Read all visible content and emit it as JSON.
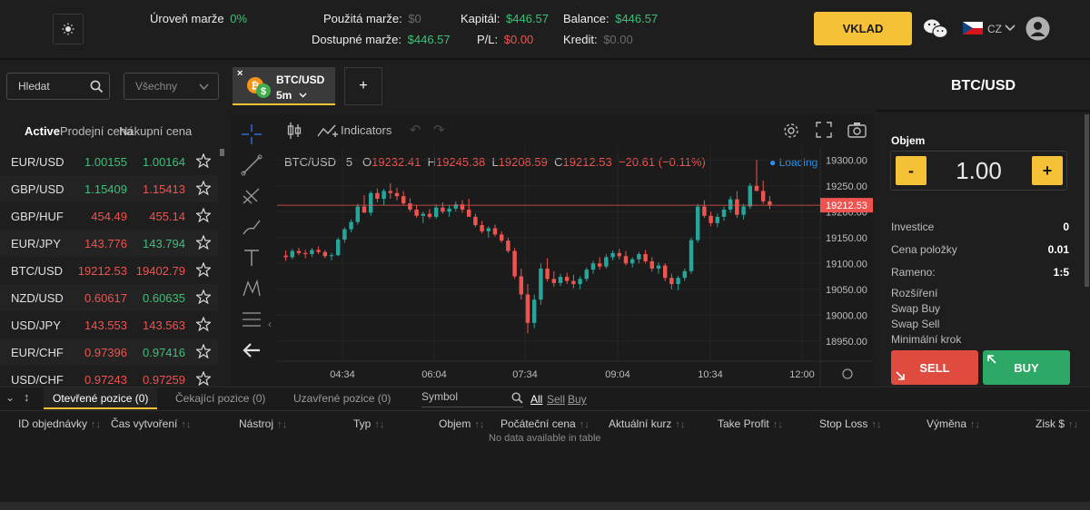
{
  "topbar": {
    "margin_level_label": "Úroveň marže",
    "margin_level_value": "0%",
    "used_margin_label": "Použitá marže:",
    "used_margin_value": "$0",
    "free_margin_label": "Dostupné marže:",
    "free_margin_value": "$446.57",
    "equity_label": "Kapitál:",
    "equity_value": "$446.57",
    "pl_label": "P/L:",
    "pl_value": "$0.00",
    "balance_label": "Balance:",
    "balance_value": "$446.57",
    "credit_label": "Kredit:",
    "credit_value": "$0.00",
    "deposit_label": "VKLAD",
    "language": "CZ",
    "icons": [
      "sun-icon",
      "wechat-icon",
      "czech-flag-icon",
      "chevron-down-icon",
      "user-avatar-icon"
    ]
  },
  "watchlist": {
    "search_placeholder": "Hledat",
    "filter_value": "Všechny",
    "col_active": "Active",
    "col_bid": "Prodejní cena",
    "col_ask": "Nákupní cena",
    "rows": [
      {
        "symbol": "EUR/USD",
        "bid": "1.00155",
        "ask": "1.00164",
        "bid_color": "#3fbf78",
        "ask_color": "#3fbf78"
      },
      {
        "symbol": "GBP/USD",
        "bid": "1.15409",
        "ask": "1.15413",
        "bid_color": "#3fbf78",
        "ask_color": "#ef5350"
      },
      {
        "symbol": "GBP/HUF",
        "bid": "454.49",
        "ask": "455.14",
        "bid_color": "#ef5350",
        "ask_color": "#ef5350"
      },
      {
        "symbol": "EUR/JPY",
        "bid": "143.776",
        "ask": "143.794",
        "bid_color": "#ef5350",
        "ask_color": "#3fbf78"
      },
      {
        "symbol": "BTC/USD",
        "bid": "19212.53",
        "ask": "19402.79",
        "bid_color": "#ef5350",
        "ask_color": "#ef5350"
      },
      {
        "symbol": "NZD/USD",
        "bid": "0.60617",
        "ask": "0.60635",
        "bid_color": "#ef5350",
        "ask_color": "#3fbf78"
      },
      {
        "symbol": "USD/JPY",
        "bid": "143.553",
        "ask": "143.563",
        "bid_color": "#ef5350",
        "ask_color": "#ef5350"
      },
      {
        "symbol": "EUR/CHF",
        "bid": "0.97396",
        "ask": "0.97416",
        "bid_color": "#ef5350",
        "ask_color": "#3fbf78"
      },
      {
        "symbol": "USD/CHF",
        "bid": "0.97243",
        "ask": "0.97259",
        "bid_color": "#ef5350",
        "ask_color": "#ef5350"
      }
    ]
  },
  "chart_tab": {
    "symbol": "BTC/USD",
    "timeframe": "5m",
    "add_label": "+"
  },
  "chart_toolbar": {
    "indicators_label": "Indicators"
  },
  "chart_legend": {
    "symbol": "BTC/USD",
    "interval": "5",
    "o_label": "O",
    "o": "19232.41",
    "h_label": "H",
    "h": "19245.38",
    "l_label": "L",
    "l": "19208.59",
    "c_label": "C",
    "c": "19212.53",
    "change": "−20.61 (−0.11%)",
    "loading": "Loading"
  },
  "chart_data": {
    "type": "candlestick",
    "title": "",
    "y_ticks": [
      "19300.00",
      "19250.00",
      "19200.00",
      "19150.00",
      "19100.00",
      "19050.00",
      "19000.00",
      "18950.00"
    ],
    "x_ticks": [
      "04:34",
      "06:04",
      "07:34",
      "09:04",
      "10:34",
      "12:00"
    ],
    "ylim": [
      18925,
      19325
    ],
    "last_price": "19212.53",
    "up_color": "#26a69a",
    "down_color": "#ef5350",
    "candles": [
      [
        19115,
        19125,
        19105,
        19112
      ],
      [
        19112,
        19128,
        19108,
        19124
      ],
      [
        19124,
        19130,
        19116,
        19120
      ],
      [
        19120,
        19126,
        19110,
        19118
      ],
      [
        19118,
        19130,
        19112,
        19126
      ],
      [
        19126,
        19133,
        19118,
        19122
      ],
      [
        19122,
        19126,
        19110,
        19114
      ],
      [
        19114,
        19120,
        19106,
        19116
      ],
      [
        19116,
        19150,
        19114,
        19146
      ],
      [
        19146,
        19170,
        19140,
        19166
      ],
      [
        19166,
        19185,
        19160,
        19180
      ],
      [
        19180,
        19215,
        19175,
        19210
      ],
      [
        19210,
        19232,
        19200,
        19198
      ],
      [
        19198,
        19240,
        19192,
        19236
      ],
      [
        19236,
        19245,
        19218,
        19225
      ],
      [
        19225,
        19244,
        19212,
        19240
      ],
      [
        19240,
        19255,
        19225,
        19236
      ],
      [
        19236,
        19246,
        19222,
        19230
      ],
      [
        19230,
        19240,
        19212,
        19216
      ],
      [
        19216,
        19226,
        19200,
        19204
      ],
      [
        19204,
        19212,
        19188,
        19192
      ],
      [
        19192,
        19200,
        19178,
        19196
      ],
      [
        19196,
        19205,
        19186,
        19190
      ],
      [
        19190,
        19214,
        19186,
        19208
      ],
      [
        19208,
        19218,
        19196,
        19200
      ],
      [
        19200,
        19212,
        19190,
        19206
      ],
      [
        19206,
        19220,
        19200,
        19214
      ],
      [
        19214,
        19222,
        19198,
        19204
      ],
      [
        19204,
        19225,
        19196,
        19190
      ],
      [
        19190,
        19196,
        19170,
        19174
      ],
      [
        19174,
        19182,
        19158,
        19162
      ],
      [
        19162,
        19172,
        19150,
        19168
      ],
      [
        19168,
        19175,
        19152,
        19156
      ],
      [
        19156,
        19162,
        19140,
        19144
      ],
      [
        19144,
        19150,
        19120,
        19124
      ],
      [
        19124,
        19130,
        19070,
        19075
      ],
      [
        19075,
        19090,
        19030,
        19040
      ],
      [
        19040,
        19060,
        18965,
        18985
      ],
      [
        18985,
        19040,
        18975,
        19030
      ],
      [
        19030,
        19100,
        19020,
        19090
      ],
      [
        19090,
        19110,
        19065,
        19070
      ],
      [
        19070,
        19085,
        19055,
        19062
      ],
      [
        19062,
        19080,
        19056,
        19074
      ],
      [
        19074,
        19082,
        19060,
        19066
      ],
      [
        19066,
        19078,
        19052,
        19060
      ],
      [
        19060,
        19075,
        19050,
        19070
      ],
      [
        19070,
        19092,
        19065,
        19088
      ],
      [
        19088,
        19105,
        19080,
        19100
      ],
      [
        19100,
        19112,
        19088,
        19094
      ],
      [
        19094,
        19118,
        19090,
        19112
      ],
      [
        19112,
        19125,
        19106,
        19120
      ],
      [
        19120,
        19128,
        19108,
        19114
      ],
      [
        19114,
        19124,
        19096,
        19100
      ],
      [
        19100,
        19112,
        19092,
        19108
      ],
      [
        19108,
        19122,
        19100,
        19118
      ],
      [
        19118,
        19126,
        19100,
        19104
      ],
      [
        19104,
        19112,
        19084,
        19090
      ],
      [
        19090,
        19102,
        19080,
        19096
      ],
      [
        19096,
        19100,
        19066,
        19072
      ],
      [
        19072,
        19080,
        19050,
        19060
      ],
      [
        19060,
        19076,
        19048,
        19072
      ],
      [
        19072,
        19090,
        19066,
        19085
      ],
      [
        19085,
        19150,
        19080,
        19145
      ],
      [
        19145,
        19215,
        19140,
        19210
      ],
      [
        19210,
        19222,
        19188,
        19192
      ],
      [
        19192,
        19200,
        19172,
        19178
      ],
      [
        19178,
        19196,
        19170,
        19190
      ],
      [
        19190,
        19210,
        19182,
        19204
      ],
      [
        19204,
        19230,
        19198,
        19224
      ],
      [
        19224,
        19240,
        19188,
        19194
      ],
      [
        19194,
        19215,
        19185,
        19210
      ],
      [
        19210,
        19255,
        19205,
        19250
      ],
      [
        19250,
        19300,
        19240,
        19240
      ],
      [
        19240,
        19260,
        19215,
        19220
      ],
      [
        19220,
        19230,
        19205,
        19212
      ]
    ]
  },
  "order_panel": {
    "title": "BTC/USD",
    "volume_label": "Objem",
    "minus": "-",
    "volume_value": "1.00",
    "plus": "+",
    "investment_label": "Investice",
    "investment_value": "0",
    "pip_value_label": "Cena položky",
    "pip_value": "0.01",
    "leverage_label": "Rameno:",
    "leverage_value": "1:5",
    "spread_label": "Rozšíření",
    "swap_buy_label": "Swap Buy",
    "swap_sell_label": "Swap Sell",
    "min_step_label": "Minimální krok",
    "sell_label": "SELL",
    "buy_label": "BUY"
  },
  "positions": {
    "tab_open": "Otevřené pozice (0)",
    "tab_pending": "Čekající pozice (0)",
    "tab_closed": "Uzavřené pozice (0)",
    "symbol_placeholder": "Symbol",
    "filter_all": "All",
    "filter_sell": "Sell",
    "filter_buy": "Buy",
    "columns": [
      "ID objednávky",
      "Čas vytvoření",
      "Nástroj",
      "Typ",
      "Objem",
      "Počáteční cena",
      "Aktuální kurz",
      "Take Profit",
      "Stop Loss",
      "Výměna",
      "Zisk $"
    ],
    "empty_text": "No data available in table"
  }
}
